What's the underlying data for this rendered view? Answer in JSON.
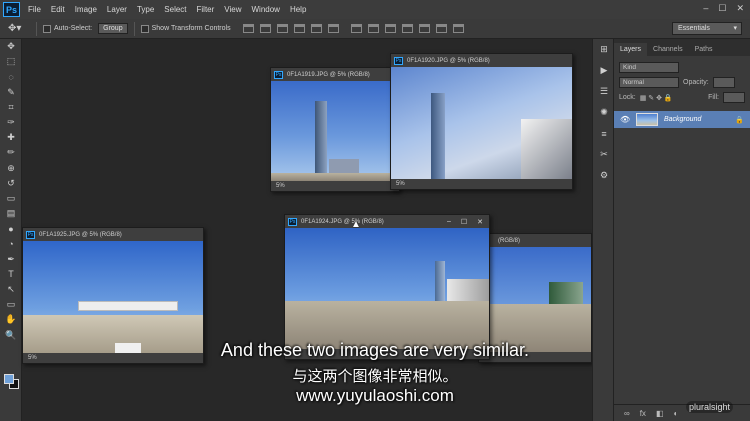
{
  "app": {
    "logo": "Ps"
  },
  "menu": [
    "File",
    "Edit",
    "Image",
    "Layer",
    "Type",
    "Select",
    "Filter",
    "View",
    "Window",
    "Help"
  ],
  "window_controls": [
    "–",
    "☐",
    "✕"
  ],
  "options_bar": {
    "auto_select_label": "Auto-Select:",
    "auto_select_value": "Group",
    "transform_label": "Show Transform Controls",
    "workspace": "Essentials"
  },
  "tools": [
    "move-icon",
    "marquee-icon",
    "lasso-icon",
    "quick-select-icon",
    "crop-icon",
    "eyedropper-icon",
    "healing-icon",
    "brush-icon",
    "stamp-icon",
    "history-brush-icon",
    "eraser-icon",
    "gradient-icon",
    "blur-icon",
    "dodge-icon",
    "pen-icon",
    "type-icon",
    "path-select-icon",
    "shape-icon",
    "hand-icon",
    "zoom-icon"
  ],
  "tool_glyphs": [
    "✥",
    "⬚",
    "◌",
    "✎",
    "⌗",
    "✑",
    "✚",
    "✏",
    "⊕",
    "↺",
    "▭",
    "▤",
    "●",
    "◔",
    "✒",
    "T",
    "↖",
    "▭",
    "✋",
    "🔍"
  ],
  "dock_glyphs": [
    "⊞",
    "▶",
    "☰",
    "✺",
    "≡",
    "✂",
    "⚙"
  ],
  "layers_panel": {
    "tabs": [
      "Layers",
      "Channels",
      "Paths"
    ],
    "kind": "Kind",
    "blend_mode": "Normal",
    "opacity_label": "Opacity:",
    "lock_label": "Lock:",
    "fill_label": "Fill:",
    "layer_name": "Background",
    "bottom_icons": [
      "∞",
      "fx",
      "◧",
      "◐",
      "▭",
      "▢",
      "🗑"
    ]
  },
  "documents": [
    {
      "title": "0F1A1919.JPG @ 5% (RGB/8)",
      "zoom": "5%"
    },
    {
      "title": "0F1A1920.JPG @ 5% (RGB/8)",
      "zoom": "5%"
    },
    {
      "title": "0F1A1925.JPG @ 5% (RGB/8)",
      "zoom": "5%"
    },
    {
      "title": "0F1A1924.JPG @ 5% (RGB/8)",
      "zoom": "5%"
    },
    {
      "title": "(RGB/8)",
      "zoom": ""
    }
  ],
  "subtitles": {
    "english": "And these two images are very similar.",
    "chinese": "与这两个图像非常相似。",
    "url": "www.yuyulaoshi.com"
  },
  "brand": "pluralsight"
}
